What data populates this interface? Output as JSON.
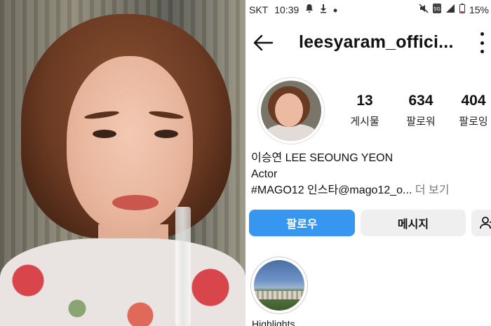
{
  "status_bar": {
    "carrier": "SKT",
    "time": "10:39",
    "battery": "15%",
    "icons": [
      "notification-icon",
      "download-icon",
      "dot-icon",
      "mute-icon",
      "5g-icon",
      "signal-icon",
      "battery-icon"
    ]
  },
  "profile": {
    "username": "leesyaram_offici...",
    "stats": [
      {
        "value": "13",
        "label": "게시물"
      },
      {
        "value": "634",
        "label": "팔로워"
      },
      {
        "value": "404",
        "label": "팔로잉"
      }
    ],
    "name": "이승연 LEE SEOUNG YEON",
    "category": "Actor",
    "bio_line": "#MAGO12 인스타@mago12_o...",
    "bio_more": "더 보기"
  },
  "actions": {
    "follow_label": "팔로우",
    "message_label": "메시지",
    "add_user_icon": "add-user-icon"
  },
  "highlights": [
    {
      "label": "Highlights"
    }
  ],
  "colors": {
    "follow_button": "#3797f0",
    "secondary_button": "#efefef",
    "text": "#111111",
    "muted": "#777777"
  }
}
